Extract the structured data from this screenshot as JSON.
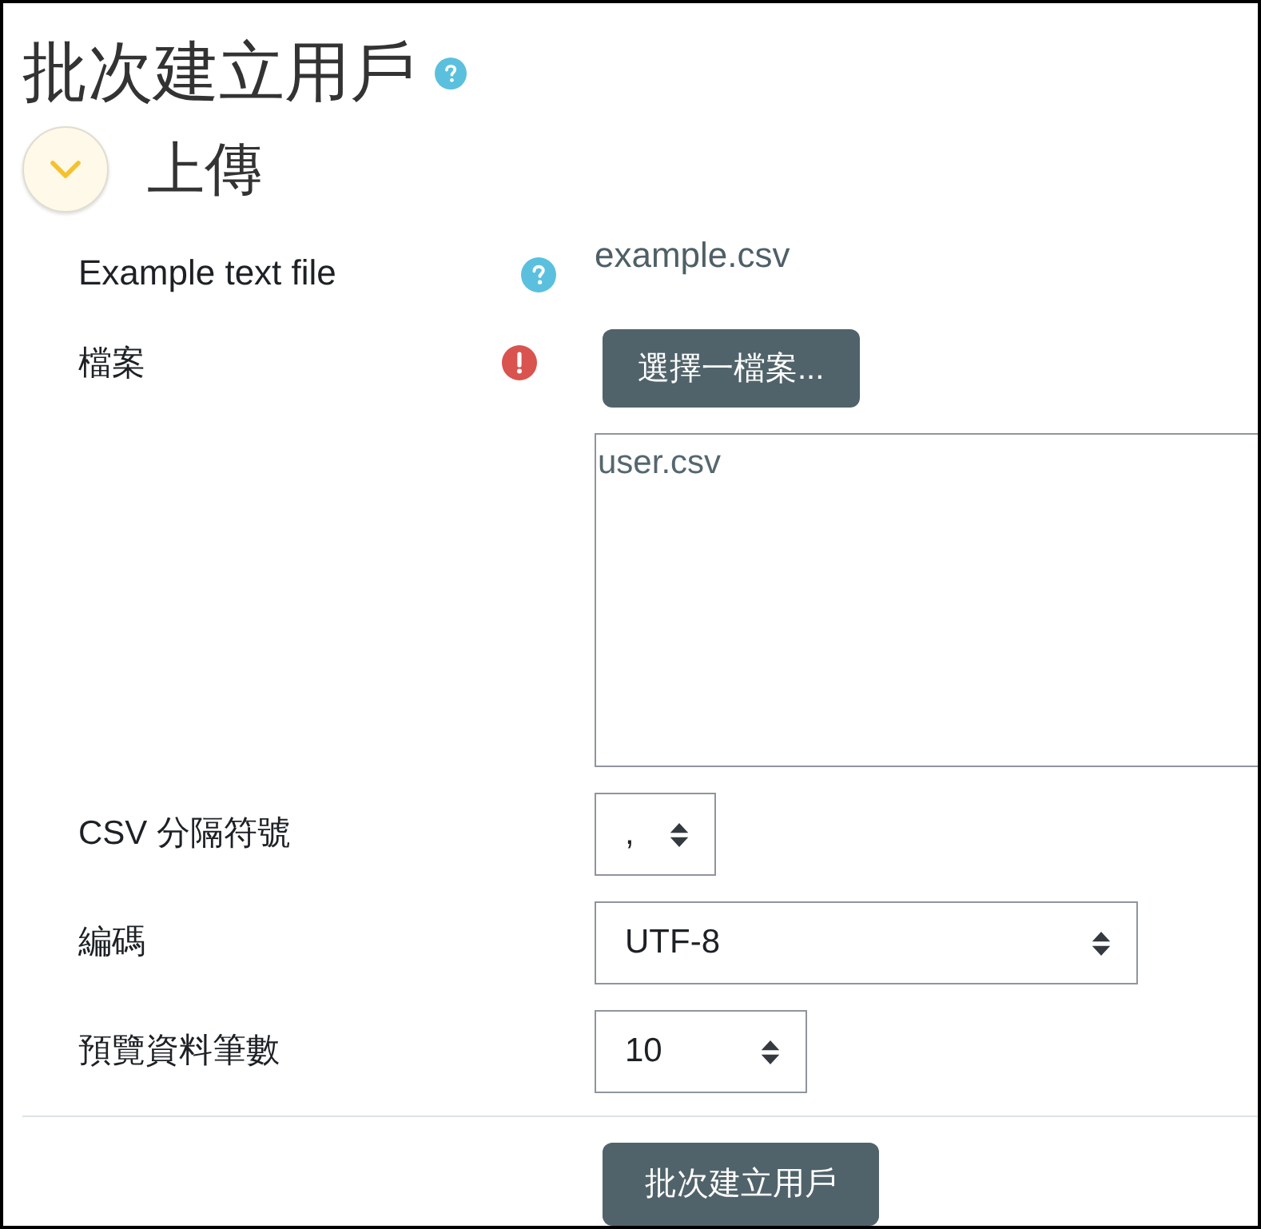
{
  "page": {
    "title": "批次建立用戶",
    "help": true
  },
  "section": {
    "title": "上傳",
    "expanded": true
  },
  "fields": [
    {
      "kind": "link",
      "label": "Example text file",
      "help": true,
      "value": "example.csv"
    },
    {
      "kind": "file",
      "label": "檔案",
      "required": true,
      "button": "選擇一檔案...",
      "files": [
        "user.csv"
      ]
    },
    {
      "kind": "select",
      "label": "CSV 分隔符號",
      "value": ","
    },
    {
      "kind": "select",
      "label": "編碼",
      "value": "UTF-8"
    },
    {
      "kind": "select",
      "label": "預覽資料筆數",
      "value": "10"
    }
  ],
  "submit": "批次建立用戶"
}
